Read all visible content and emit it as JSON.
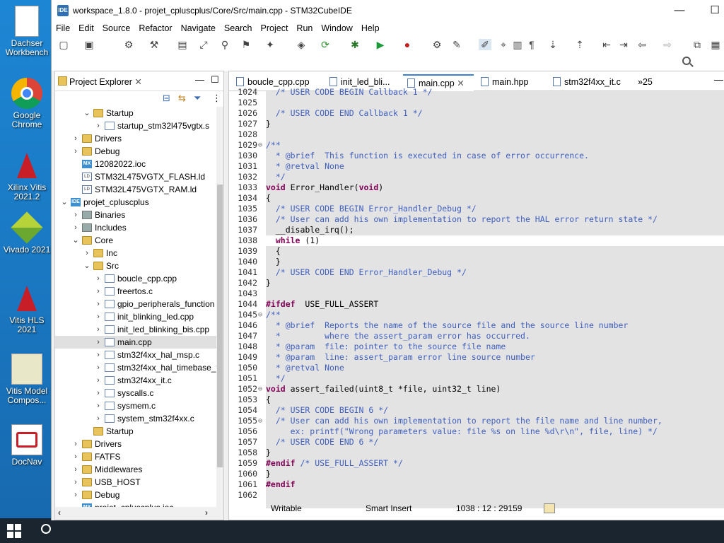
{
  "desktop": {
    "icons": [
      {
        "label": "Dachser Workbench",
        "name": "dachser-workbench-icon"
      },
      {
        "label": "Google Chrome",
        "name": "chrome-icon"
      },
      {
        "label": "Xilinx Vitis 2021.2",
        "name": "xilinx-vitis-icon"
      },
      {
        "label": "Vivado 2021",
        "name": "vivado-icon"
      },
      {
        "label": "Vitis HLS 2021",
        "name": "vitis-hls-icon"
      },
      {
        "label": "Vitis Model Compos...",
        "name": "vitis-model-composer-icon"
      },
      {
        "label": "DocNav",
        "name": "docnav-icon"
      }
    ]
  },
  "window": {
    "title": "workspace_1.8.0 - projet_cpluscplus/Core/Src/main.cpp - STM32CubeIDE",
    "app_icon": "IDE",
    "minimize": "—",
    "maximize": "☐"
  },
  "menu": [
    "File",
    "Edit",
    "Source",
    "Refactor",
    "Navigate",
    "Search",
    "Project",
    "Run",
    "Window",
    "Help"
  ],
  "project_explorer": {
    "title": "Project Explorer",
    "tree": [
      {
        "label": "Startup",
        "indent": 2,
        "twisty": "v",
        "icon": "folder"
      },
      {
        "label": "startup_stm32l475vgtx.s",
        "indent": 3,
        "twisty": ">",
        "icon": "file"
      },
      {
        "label": "Drivers",
        "indent": 1,
        "twisty": ">",
        "icon": "folder"
      },
      {
        "label": "Debug",
        "indent": 1,
        "twisty": ">",
        "icon": "folder"
      },
      {
        "label": "12082022.ioc",
        "indent": 1,
        "twisty": "",
        "icon": "mx"
      },
      {
        "label": "STM32L475VGTX_FLASH.ld",
        "indent": 1,
        "twisty": "",
        "icon": "ld"
      },
      {
        "label": "STM32L475VGTX_RAM.ld",
        "indent": 1,
        "twisty": "",
        "icon": "ld"
      },
      {
        "label": "projet_cpluscplus",
        "indent": 0,
        "twisty": "v",
        "icon": "ide"
      },
      {
        "label": "Binaries",
        "indent": 1,
        "twisty": ">",
        "icon": "bin"
      },
      {
        "label": "Includes",
        "indent": 1,
        "twisty": ">",
        "icon": "bin"
      },
      {
        "label": "Core",
        "indent": 1,
        "twisty": "v",
        "icon": "folder"
      },
      {
        "label": "Inc",
        "indent": 2,
        "twisty": ">",
        "icon": "folder"
      },
      {
        "label": "Src",
        "indent": 2,
        "twisty": "v",
        "icon": "folder"
      },
      {
        "label": "boucle_cpp.cpp",
        "indent": 3,
        "twisty": ">",
        "icon": "file"
      },
      {
        "label": "freertos.c",
        "indent": 3,
        "twisty": ">",
        "icon": "file"
      },
      {
        "label": "gpio_peripherals_function",
        "indent": 3,
        "twisty": ">",
        "icon": "file"
      },
      {
        "label": "init_blinking_led.cpp",
        "indent": 3,
        "twisty": ">",
        "icon": "file"
      },
      {
        "label": "init_led_blinking_bis.cpp",
        "indent": 3,
        "twisty": ">",
        "icon": "file"
      },
      {
        "label": "main.cpp",
        "indent": 3,
        "twisty": ">",
        "icon": "file",
        "selected": true
      },
      {
        "label": "stm32f4xx_hal_msp.c",
        "indent": 3,
        "twisty": ">",
        "icon": "file"
      },
      {
        "label": "stm32f4xx_hal_timebase_t",
        "indent": 3,
        "twisty": ">",
        "icon": "file"
      },
      {
        "label": "stm32f4xx_it.c",
        "indent": 3,
        "twisty": ">",
        "icon": "file"
      },
      {
        "label": "syscalls.c",
        "indent": 3,
        "twisty": ">",
        "icon": "file"
      },
      {
        "label": "sysmem.c",
        "indent": 3,
        "twisty": ">",
        "icon": "file"
      },
      {
        "label": "system_stm32f4xx.c",
        "indent": 3,
        "twisty": ">",
        "icon": "file"
      },
      {
        "label": "Startup",
        "indent": 2,
        "twisty": "",
        "icon": "folder"
      },
      {
        "label": "Drivers",
        "indent": 1,
        "twisty": ">",
        "icon": "folder"
      },
      {
        "label": "FATFS",
        "indent": 1,
        "twisty": ">",
        "icon": "folder"
      },
      {
        "label": "Middlewares",
        "indent": 1,
        "twisty": ">",
        "icon": "folder"
      },
      {
        "label": "USB_HOST",
        "indent": 1,
        "twisty": ">",
        "icon": "folder"
      },
      {
        "label": "Debug",
        "indent": 1,
        "twisty": ">",
        "icon": "folder"
      },
      {
        "label": "projet_cpluscplus.ioc",
        "indent": 1,
        "twisty": "",
        "icon": "mx"
      }
    ]
  },
  "editor": {
    "tabs": [
      {
        "label": "boucle_cpp.cpp",
        "active": false
      },
      {
        "label": "init_led_bli...",
        "active": false
      },
      {
        "label": "main.cpp",
        "active": true,
        "close": "✕"
      },
      {
        "label": "main.hpp",
        "active": false
      },
      {
        "label": "stm32f4xx_it.c",
        "active": false
      }
    ],
    "overflow_label": "»25",
    "lines": [
      {
        "n": "1024",
        "f": "",
        "h": "  <span class='cm'>/* USER CODE BEGIN Callback 1 */</span>"
      },
      {
        "n": "1025",
        "f": "",
        "h": ""
      },
      {
        "n": "1026",
        "f": "",
        "h": "  <span class='cm'>/* USER CODE END Callback 1 */</span>"
      },
      {
        "n": "1027",
        "f": "",
        "h": "}"
      },
      {
        "n": "1028",
        "f": "",
        "h": ""
      },
      {
        "n": "1029",
        "f": "⊖",
        "h": "<span class='cm'>/**</span>"
      },
      {
        "n": "1030",
        "f": "",
        "h": "<span class='cm'>  * @brief  This function is executed in case of error occurrence.</span>"
      },
      {
        "n": "1031",
        "f": "",
        "h": "<span class='cm'>  * @retval None</span>"
      },
      {
        "n": "1032",
        "f": "",
        "h": "<span class='cm'>  */</span>"
      },
      {
        "n": "1033",
        "f": "",
        "h": "<span class='kw'>void</span> Error_Handler(<span class='kw'>void</span>)"
      },
      {
        "n": "1034",
        "f": "",
        "h": "{"
      },
      {
        "n": "1035",
        "f": "",
        "h": "  <span class='cm'>/* USER CODE BEGIN Error_Handler_Debug */</span>"
      },
      {
        "n": "1036",
        "f": "",
        "h": "  <span class='cm'>/* User can add his own implementation to report the HAL error return state */</span>"
      },
      {
        "n": "1037",
        "f": "",
        "h": "  __disable_irq();"
      },
      {
        "n": "1038",
        "f": "",
        "h": "  <span class='kw'>while</span> (1)",
        "cur": true
      },
      {
        "n": "1039",
        "f": "",
        "h": "  {"
      },
      {
        "n": "1040",
        "f": "",
        "h": "  }"
      },
      {
        "n": "1041",
        "f": "",
        "h": "  <span class='cm'>/* USER CODE END Error_Handler_Debug */</span>"
      },
      {
        "n": "1042",
        "f": "",
        "h": "}"
      },
      {
        "n": "1043",
        "f": "",
        "h": ""
      },
      {
        "n": "1044",
        "f": "",
        "h": "<span class='pp'>#ifdef</span>  USE_FULL_ASSERT"
      },
      {
        "n": "1045",
        "f": "⊖",
        "h": "<span class='cm'>/**</span>"
      },
      {
        "n": "1046",
        "f": "",
        "h": "<span class='cm'>  * @brief  Reports the name of the source file and the source line number</span>"
      },
      {
        "n": "1047",
        "f": "",
        "h": "<span class='cm'>  *         where the assert_param error has occurred.</span>"
      },
      {
        "n": "1048",
        "f": "",
        "h": "<span class='cm'>  * @param  file: pointer to the source file name</span>"
      },
      {
        "n": "1049",
        "f": "",
        "h": "<span class='cm'>  * @param  line: assert_param error line source number</span>"
      },
      {
        "n": "1050",
        "f": "",
        "h": "<span class='cm'>  * @retval None</span>"
      },
      {
        "n": "1051",
        "f": "",
        "h": "<span class='cm'>  */</span>"
      },
      {
        "n": "1052",
        "f": "⊖",
        "h": "<span class='kw'>void</span> assert_failed(uint8_t *file, uint32_t line)"
      },
      {
        "n": "1053",
        "f": "",
        "h": "{"
      },
      {
        "n": "1054",
        "f": "",
        "h": "  <span class='cm'>/* USER CODE BEGIN 6 */</span>"
      },
      {
        "n": "1055",
        "f": "⊖",
        "h": "  <span class='cm'>/* User can add his own implementation to report the file name and line number,</span>"
      },
      {
        "n": "1056",
        "f": "",
        "h": "<span class='cm'>     ex: printf(\"Wrong parameters value: file %s on line %d\\r\\n\", file, line) */</span>"
      },
      {
        "n": "1057",
        "f": "",
        "h": "  <span class='cm'>/* USER CODE END 6 */</span>"
      },
      {
        "n": "1058",
        "f": "",
        "h": "}"
      },
      {
        "n": "1059",
        "f": "",
        "h": "<span class='pp'>#endif</span> <span class='cm'>/* USE_FULL_ASSERT */</span>"
      },
      {
        "n": "1060",
        "f": "",
        "h": "}"
      },
      {
        "n": "1061",
        "f": "",
        "h": "<span class='pp'>#endif</span>"
      },
      {
        "n": "1062",
        "f": "",
        "h": ""
      }
    ]
  },
  "status": {
    "mode": "Writable",
    "insert": "Smart Insert",
    "position": "1038 : 12 : 29159"
  },
  "colors": {
    "accent": "#3f7fcf",
    "keyword": "#7f0055",
    "comment": "#3f5fbf",
    "desktop": "#1a78c2"
  }
}
